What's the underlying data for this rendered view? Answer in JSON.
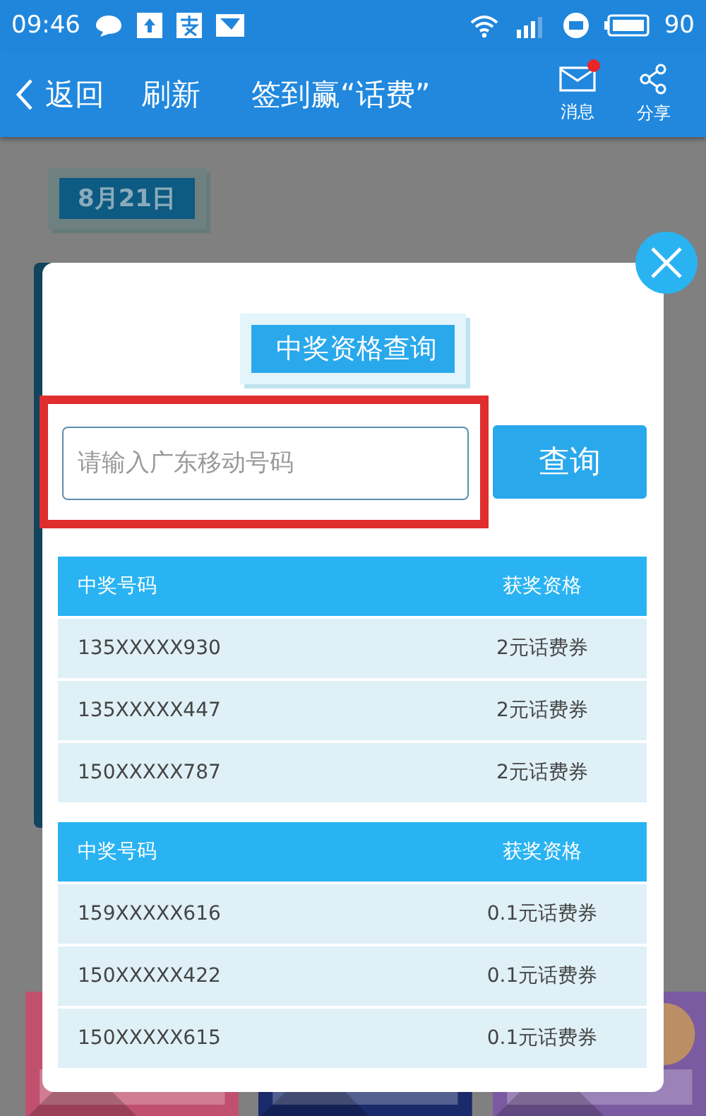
{
  "status_bar": {
    "time": "09:46",
    "battery": "90"
  },
  "nav": {
    "back": "返回",
    "refresh": "刷新",
    "title": "签到赢“话费”",
    "actions": [
      {
        "label": "消息",
        "kind": "mail",
        "badge": true
      },
      {
        "label": "分享",
        "kind": "share",
        "badge": false
      }
    ]
  },
  "page": {
    "date": "8月21日"
  },
  "dialog": {
    "title": "中奖资格查询",
    "input": {
      "placeholder": "请输入广东移动号码",
      "highlighted": true
    },
    "button": "查询",
    "tables": [
      {
        "columns": [
          "中奖号码",
          "获奖资格"
        ],
        "rows": [
          [
            "135XXXXX930",
            "2元话费券"
          ],
          [
            "135XXXXX447",
            "2元话费券"
          ],
          [
            "150XXXXX787",
            "2元话费券"
          ]
        ]
      },
      {
        "columns": [
          "中奖号码",
          "获奖资格"
        ],
        "rows": [
          [
            "159XXXXX616",
            "0.1元话费券"
          ],
          [
            "150XXXXX422",
            "0.1元话费券"
          ],
          [
            "150XXXXX615",
            "0.1元话费券"
          ]
        ]
      }
    ]
  }
}
